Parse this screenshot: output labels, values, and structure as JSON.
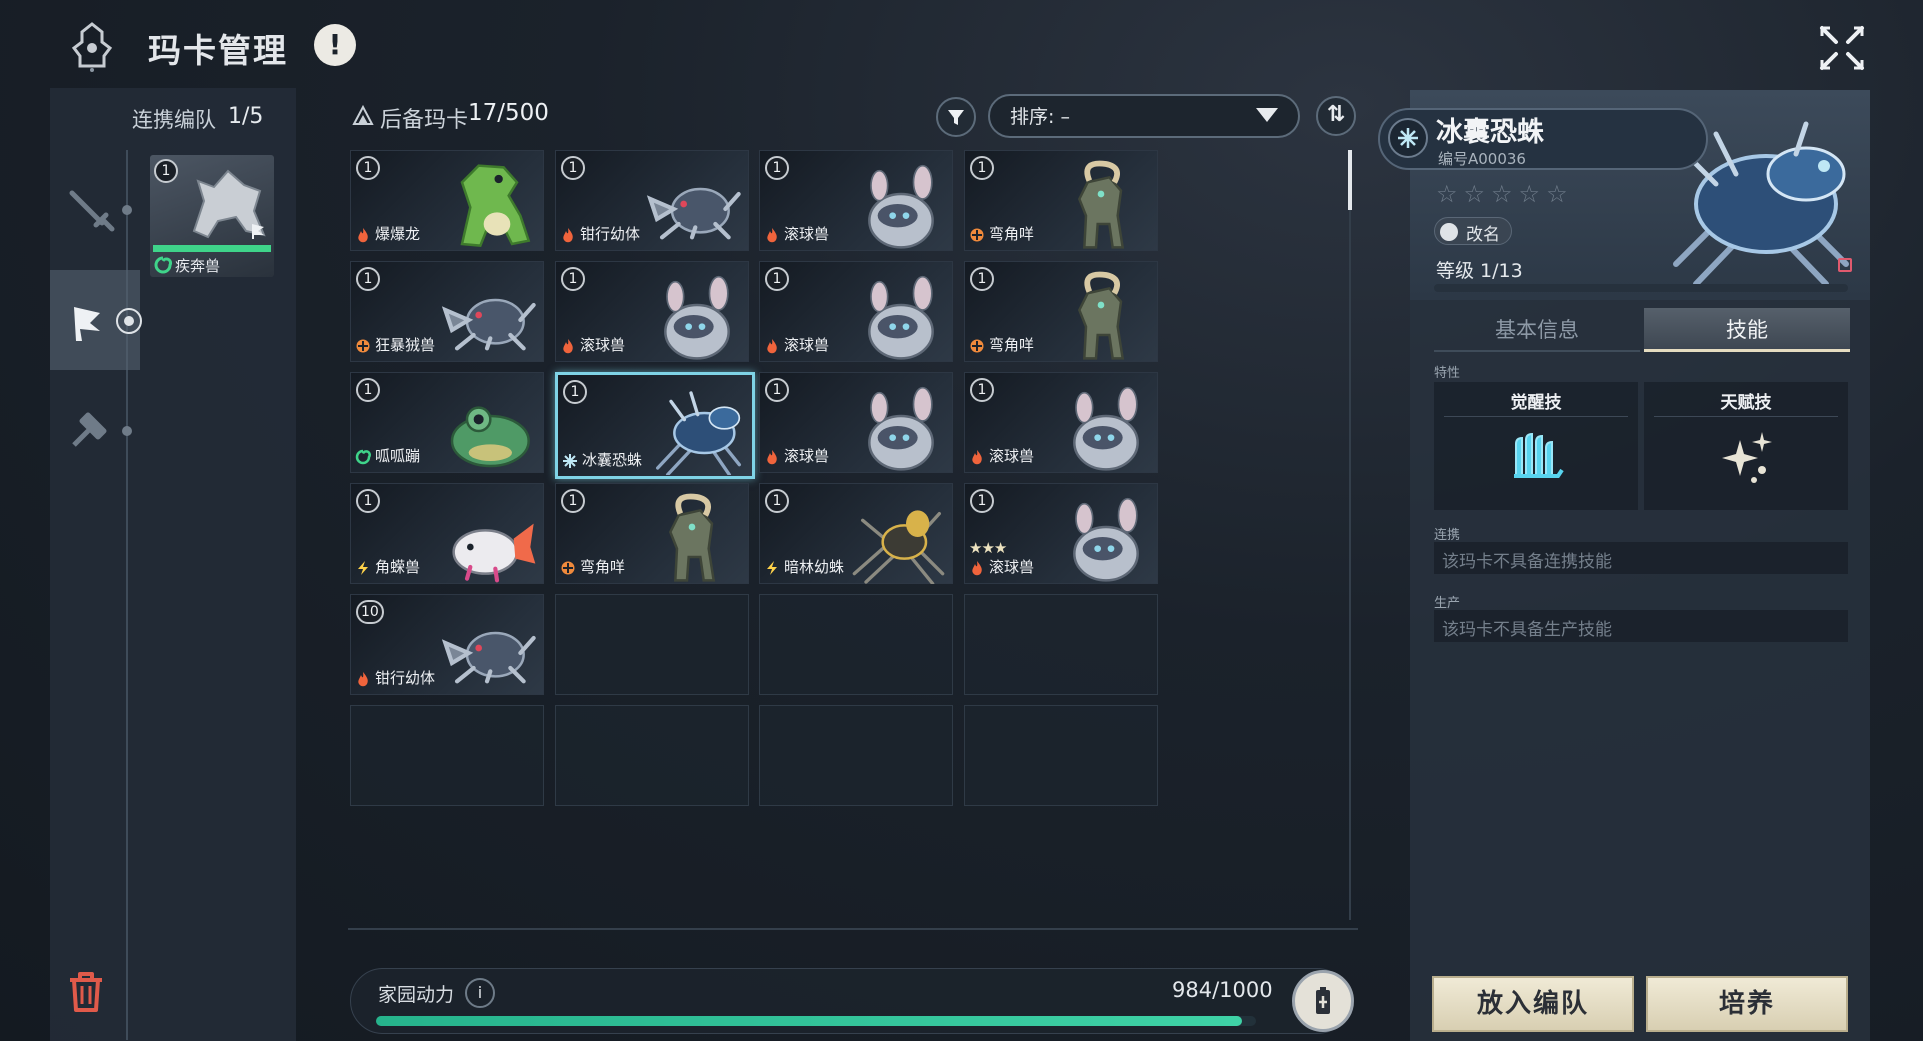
{
  "header": {
    "title": "玛卡管理",
    "alert": "!"
  },
  "team": {
    "title": "连携编队",
    "count": "1/5",
    "members": [
      {
        "level": "1",
        "name": "疾奔兽",
        "element": "wind",
        "hp_fraction": 1.0
      }
    ]
  },
  "reserve": {
    "label": "后备玛卡",
    "count": "17/500",
    "sort_label": "排序: –",
    "cards": [
      {
        "level": "1",
        "name": "爆爆龙",
        "element": "fire",
        "stars": "",
        "art": "dino"
      },
      {
        "level": "1",
        "name": "钳行幼体",
        "element": "fire",
        "stars": "",
        "art": "crab"
      },
      {
        "level": "1",
        "name": "滚球兽",
        "element": "fire",
        "stars": "",
        "art": "mouse"
      },
      {
        "level": "1",
        "name": "弯角咩",
        "element": "earth",
        "stars": "",
        "art": "goat"
      },
      {
        "level": "1",
        "name": "狂暴狨兽",
        "element": "earth",
        "stars": "",
        "art": "crab"
      },
      {
        "level": "1",
        "name": "滚球兽",
        "element": "fire",
        "stars": "",
        "art": "mouse"
      },
      {
        "level": "1",
        "name": "滚球兽",
        "element": "fire",
        "stars": "",
        "art": "mouse"
      },
      {
        "level": "1",
        "name": "弯角咩",
        "element": "earth",
        "stars": "",
        "art": "goat"
      },
      {
        "level": "1",
        "name": "呱呱蹦",
        "element": "wind",
        "stars": "",
        "art": "frog"
      },
      {
        "level": "1",
        "name": "冰囊恐蛛",
        "element": "ice",
        "stars": "",
        "art": "spider",
        "selected": true
      },
      {
        "level": "1",
        "name": "滚球兽",
        "element": "fire",
        "stars": "",
        "art": "mouse"
      },
      {
        "level": "1",
        "name": "滚球兽",
        "element": "fire",
        "stars": "",
        "art": "mouse"
      },
      {
        "level": "1",
        "name": "角蝾兽",
        "element": "thunder",
        "stars": "",
        "art": "axolotl"
      },
      {
        "level": "1",
        "name": "弯角咩",
        "element": "earth",
        "stars": "",
        "art": "goat"
      },
      {
        "level": "1",
        "name": "暗林幼蛛",
        "element": "thunder",
        "stars": "",
        "art": "spider-gold"
      },
      {
        "level": "1",
        "name": "滚球兽",
        "element": "fire",
        "stars": "★★★",
        "art": "mouse"
      },
      {
        "level": "10",
        "name": "钳行幼体",
        "element": "fire",
        "stars": "",
        "art": "crab"
      }
    ]
  },
  "home_power": {
    "label": "家园动力",
    "info": "i",
    "value": "984/1000",
    "fraction": 0.984
  },
  "detail": {
    "name": "冰囊恐蛛",
    "id": "编号A00036",
    "stars": "☆☆☆☆☆",
    "rename": "改名",
    "level": "等级  1/13",
    "exp_fraction": 0.0,
    "tabs": {
      "basic": "基本信息",
      "skill": "技能"
    },
    "trait_label": "特性",
    "awaken_title": "觉醒技",
    "talent_title": "天赋技",
    "link_label": "连携",
    "link_text": "该玛卡不具备连携技能",
    "prod_label": "生产",
    "prod_text": "该玛卡不具备生产技能",
    "put_btn": "放入编队",
    "train_btn": "培养"
  },
  "colors": {
    "accent_select": "#7fd3e6",
    "fire": "#f0643c",
    "earth": "#f08a3c",
    "wind": "#3fd48a",
    "ice": "#bfe8f5",
    "thunder": "#ffd24a",
    "power_fill": "#3fd2a6"
  }
}
